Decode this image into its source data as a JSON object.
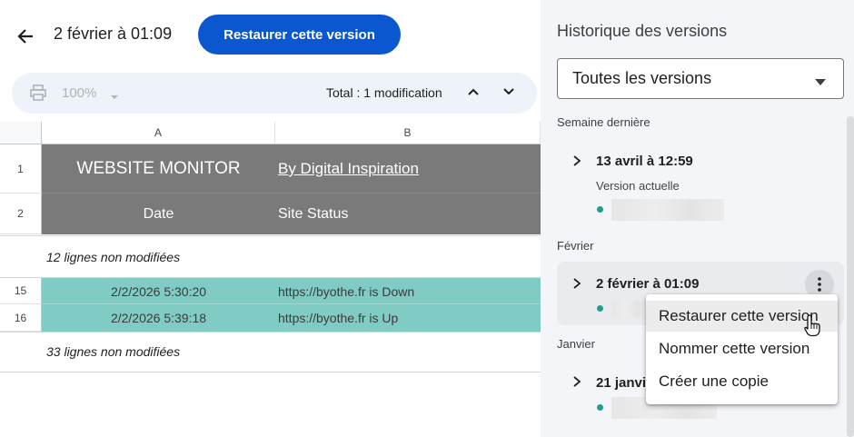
{
  "header": {
    "title": "2 février à 01:09",
    "restore_label": "Restaurer cette version"
  },
  "toolbar": {
    "zoom": "100%",
    "total": "Total : 1 modification"
  },
  "sheet": {
    "columns": [
      "A",
      "B"
    ],
    "header_rows": [
      {
        "row": "1",
        "a": "WEBSITE MONITOR",
        "b": "By Digital Inspiration"
      },
      {
        "row": "2",
        "a": "Date",
        "b": "Site Status"
      }
    ],
    "unchanged_before": "12 lignes non modifiées",
    "changed_rows": [
      {
        "row": "15",
        "a": "2/2/2026 5:30:20",
        "b": "https://byothe.fr is Down"
      },
      {
        "row": "16",
        "a": "2/2/2026 5:39:18",
        "b": "https://byothe.fr is Up"
      }
    ],
    "unchanged_after": "33 lignes non modifiées",
    "colors": {
      "header_gray": "#7a7a7a",
      "changed_teal": "#80cbc4"
    }
  },
  "panel": {
    "title": "Historique des versions",
    "filter": "Toutes les versions",
    "sections": [
      {
        "label": "Semaine dernière",
        "versions": [
          {
            "title": "13 avril à 12:59",
            "subtitle": "Version actuelle"
          }
        ]
      },
      {
        "label": "Février",
        "versions": [
          {
            "title": "2 février à 01:09"
          }
        ]
      },
      {
        "label": "Janvier",
        "versions": [
          {
            "title": "21 janvi"
          }
        ]
      }
    ]
  },
  "context_menu": {
    "items": [
      "Restaurer cette version",
      "Nommer cette version",
      "Créer une copie"
    ]
  },
  "colors": {
    "accent": "#0b57d0",
    "panel_bg": "#f3f5f9",
    "dot": "#1e9e8e"
  }
}
